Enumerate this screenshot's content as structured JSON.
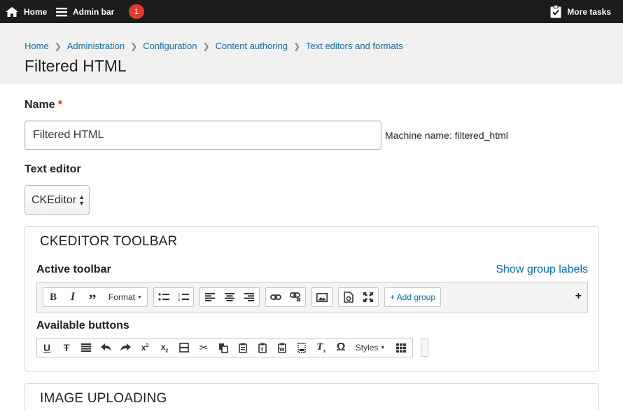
{
  "adminbar": {
    "home_label": "Home",
    "menu_label": "Admin bar",
    "badge_count": "1",
    "tasks_label": "More tasks"
  },
  "breadcrumb": [
    "Home",
    "Administration",
    "Configuration",
    "Content authoring",
    "Text editors and formats"
  ],
  "page_title": "Filtered HTML",
  "form": {
    "name_label": "Name",
    "required_mark": "*",
    "name_value": "Filtered HTML",
    "machine_name": "Machine name: filtered_html",
    "editor_label": "Text editor",
    "editor_value": "CKEditor"
  },
  "ckeditor": {
    "legend": "CKEDITOR TOOLBAR",
    "active_label": "Active toolbar",
    "show_group_labels": "Show group labels",
    "format_label": "Format",
    "add_group": "+ Add group",
    "plus": "+",
    "available_label": "Available buttons",
    "styles_label": "Styles"
  },
  "image_uploading": {
    "legend": "IMAGE UPLOADING"
  },
  "colors": {
    "link": "#0b6fb0",
    "adminbar": "#1c1c1c",
    "badge": "#e43a2e"
  }
}
